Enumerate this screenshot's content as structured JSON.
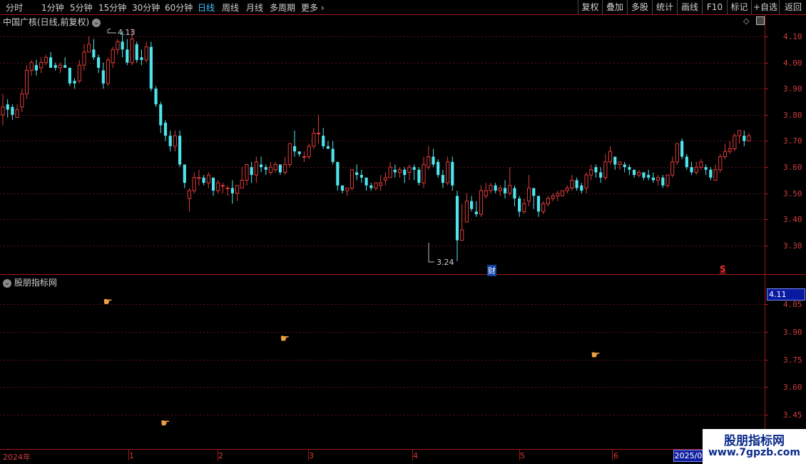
{
  "toolbar": {
    "left_tabs": [
      "分时",
      "1分钟",
      "5分钟",
      "15分钟",
      "30分钟",
      "60分钟",
      "日线",
      "周线",
      "月线",
      "多周期",
      "更多"
    ],
    "active_tab": "日线",
    "right_buttons": [
      "复权",
      "叠加",
      "多股",
      "统计",
      "画线",
      "F10",
      "标记",
      "+自选",
      "返回"
    ]
  },
  "main_panel": {
    "title": "中国广核(日线,前复权)",
    "y_labels": [
      "4.10",
      "4.00",
      "3.90",
      "3.80",
      "3.70",
      "3.60",
      "3.50",
      "3.40",
      "3.30"
    ],
    "high_annotation": "4.13",
    "low_annotation": "3.24",
    "marker_cai": "财",
    "marker_s": "S"
  },
  "indicator_panel": {
    "title": "股朋指标网",
    "y_labels": [
      "4.05",
      "3.90",
      "3.75",
      "3.60",
      "3.45"
    ],
    "current_value": "4.11"
  },
  "x_axis": {
    "labels": [
      "2024年",
      "1",
      "2",
      "3",
      "4",
      "5",
      "6"
    ],
    "current_date": "2025/0"
  },
  "watermark": {
    "line1": "股朋指标网",
    "line2": "www.7gpzb.com"
  },
  "colors": {
    "up": "#e23b3b",
    "down": "#4ee6ee",
    "axis": "#a01818",
    "grid": "#5a1414",
    "active_tab": "#3ec6ff"
  },
  "chart_data": {
    "type": "candlestick",
    "price_range": [
      3.2,
      4.15
    ],
    "candles": [
      [
        3.8,
        3.83,
        3.88,
        3.76
      ],
      [
        3.84,
        3.82,
        3.86,
        3.79
      ],
      [
        3.83,
        3.8,
        3.84,
        3.78
      ],
      [
        3.79,
        3.82,
        3.84,
        3.79
      ],
      [
        3.83,
        3.88,
        3.9,
        3.81
      ],
      [
        3.88,
        3.97,
        3.99,
        3.86
      ],
      [
        3.97,
        4.0,
        4.01,
        3.95
      ],
      [
        3.99,
        3.97,
        4.01,
        3.95
      ],
      [
        3.98,
        4.0,
        4.02,
        3.96
      ],
      [
        4.0,
        4.02,
        4.03,
        3.99
      ],
      [
        4.02,
        3.98,
        4.04,
        3.98
      ],
      [
        3.99,
        3.98,
        4.0,
        3.97
      ],
      [
        3.98,
        3.99,
        4.0,
        3.96
      ],
      [
        3.99,
        3.98,
        4.02,
        3.98
      ],
      [
        3.98,
        3.92,
        3.98,
        3.91
      ],
      [
        3.93,
        3.92,
        3.94,
        3.9
      ],
      [
        3.93,
        3.99,
        4.01,
        3.92
      ],
      [
        3.99,
        4.04,
        4.07,
        3.97
      ],
      [
        4.04,
        4.07,
        4.1,
        4.04
      ],
      [
        4.05,
        4.02,
        4.09,
        4.01
      ],
      [
        4.02,
        3.98,
        4.03,
        3.96
      ],
      [
        3.97,
        3.92,
        4.0,
        3.9
      ],
      [
        3.92,
        4.01,
        4.02,
        3.91
      ],
      [
        4.0,
        4.05,
        4.06,
        3.98
      ],
      [
        4.05,
        4.08,
        4.09,
        4.03
      ],
      [
        4.08,
        4.05,
        4.12,
        4.02
      ],
      [
        4.05,
        4.0,
        4.09,
        3.99
      ],
      [
        4.0,
        4.09,
        4.13,
        3.99
      ],
      [
        4.07,
        4.01,
        4.08,
        4.0
      ],
      [
        4.02,
        4.01,
        4.05,
        3.99
      ],
      [
        4.01,
        4.06,
        4.08,
        4.0
      ],
      [
        4.06,
        3.9,
        4.08,
        3.89
      ],
      [
        3.9,
        3.84,
        3.91,
        3.83
      ],
      [
        3.84,
        3.76,
        3.85,
        3.73
      ],
      [
        3.77,
        3.72,
        3.78,
        3.7
      ],
      [
        3.72,
        3.68,
        3.74,
        3.66
      ],
      [
        3.68,
        3.72,
        3.74,
        3.66
      ],
      [
        3.72,
        3.61,
        3.74,
        3.6
      ],
      [
        3.61,
        3.54,
        3.61,
        3.52
      ],
      [
        3.48,
        3.51,
        3.52,
        3.43
      ],
      [
        3.51,
        3.56,
        3.58,
        3.5
      ],
      [
        3.56,
        3.56,
        3.59,
        3.53
      ],
      [
        3.56,
        3.54,
        3.57,
        3.53
      ],
      [
        3.54,
        3.57,
        3.58,
        3.52
      ],
      [
        3.56,
        3.51,
        3.56,
        3.49
      ],
      [
        3.51,
        3.54,
        3.55,
        3.5
      ],
      [
        3.53,
        3.53,
        3.54,
        3.5
      ],
      [
        3.52,
        3.52,
        3.53,
        3.49
      ],
      [
        3.52,
        3.5,
        3.55,
        3.46
      ],
      [
        3.5,
        3.53,
        3.53,
        3.47
      ],
      [
        3.52,
        3.55,
        3.6,
        3.52
      ],
      [
        3.55,
        3.61,
        3.61,
        3.53
      ],
      [
        3.6,
        3.57,
        3.62,
        3.54
      ],
      [
        3.57,
        3.62,
        3.64,
        3.54
      ],
      [
        3.61,
        3.6,
        3.64,
        3.58
      ],
      [
        3.6,
        3.59,
        3.61,
        3.57
      ],
      [
        3.58,
        3.6,
        3.62,
        3.57
      ],
      [
        3.59,
        3.61,
        3.62,
        3.58
      ],
      [
        3.61,
        3.58,
        3.61,
        3.57
      ],
      [
        3.58,
        3.61,
        3.64,
        3.57
      ],
      [
        3.61,
        3.69,
        3.69,
        3.6
      ],
      [
        3.68,
        3.66,
        3.74,
        3.64
      ],
      [
        3.66,
        3.65,
        3.66,
        3.64
      ],
      [
        3.64,
        3.64,
        3.66,
        3.62
      ],
      [
        3.64,
        3.68,
        3.69,
        3.63
      ],
      [
        3.68,
        3.73,
        3.75,
        3.67
      ],
      [
        3.73,
        3.73,
        3.8,
        3.69
      ],
      [
        3.72,
        3.68,
        3.75,
        3.67
      ],
      [
        3.68,
        3.67,
        3.7,
        3.67
      ],
      [
        3.67,
        3.62,
        3.7,
        3.61
      ],
      [
        3.62,
        3.53,
        3.62,
        3.51
      ],
      [
        3.53,
        3.51,
        3.53,
        3.5
      ],
      [
        3.51,
        3.52,
        3.52,
        3.49
      ],
      [
        3.52,
        3.59,
        3.59,
        3.51
      ],
      [
        3.58,
        3.57,
        3.61,
        3.55
      ],
      [
        3.57,
        3.56,
        3.59,
        3.54
      ],
      [
        3.56,
        3.53,
        3.56,
        3.51
      ],
      [
        3.53,
        3.52,
        3.54,
        3.51
      ],
      [
        3.52,
        3.54,
        3.54,
        3.51
      ],
      [
        3.53,
        3.54,
        3.57,
        3.51
      ],
      [
        3.55,
        3.56,
        3.58,
        3.53
      ],
      [
        3.56,
        3.6,
        3.62,
        3.56
      ],
      [
        3.59,
        3.58,
        3.61,
        3.56
      ],
      [
        3.58,
        3.59,
        3.6,
        3.56
      ],
      [
        3.59,
        3.57,
        3.6,
        3.54
      ],
      [
        3.58,
        3.6,
        3.61,
        3.55
      ],
      [
        3.6,
        3.59,
        3.61,
        3.55
      ],
      [
        3.59,
        3.54,
        3.6,
        3.53
      ],
      [
        3.54,
        3.61,
        3.64,
        3.52
      ],
      [
        3.6,
        3.64,
        3.68,
        3.59
      ],
      [
        3.64,
        3.61,
        3.67,
        3.6
      ],
      [
        3.62,
        3.57,
        3.63,
        3.56
      ],
      [
        3.57,
        3.54,
        3.59,
        3.52
      ],
      [
        3.54,
        3.62,
        3.64,
        3.53
      ],
      [
        3.62,
        3.53,
        3.64,
        3.51
      ],
      [
        3.49,
        3.32,
        3.51,
        3.24
      ],
      [
        3.32,
        3.36,
        3.46,
        3.32
      ],
      [
        3.39,
        3.47,
        3.5,
        3.39
      ],
      [
        3.47,
        3.44,
        3.49,
        3.43
      ],
      [
        3.43,
        3.42,
        3.47,
        3.41
      ],
      [
        3.42,
        3.51,
        3.53,
        3.41
      ],
      [
        3.49,
        3.51,
        3.54,
        3.48
      ],
      [
        3.51,
        3.53,
        3.54,
        3.5
      ],
      [
        3.53,
        3.51,
        3.54,
        3.5
      ],
      [
        3.51,
        3.52,
        3.53,
        3.49
      ],
      [
        3.52,
        3.5,
        3.55,
        3.48
      ],
      [
        3.5,
        3.53,
        3.6,
        3.49
      ],
      [
        3.52,
        3.48,
        3.53,
        3.45
      ],
      [
        3.48,
        3.43,
        3.49,
        3.41
      ],
      [
        3.43,
        3.46,
        3.48,
        3.42
      ],
      [
        3.47,
        3.52,
        3.57,
        3.45
      ],
      [
        3.52,
        3.49,
        3.52,
        3.44
      ],
      [
        3.49,
        3.43,
        3.49,
        3.41
      ],
      [
        3.43,
        3.46,
        3.47,
        3.42
      ],
      [
        3.46,
        3.48,
        3.49,
        3.45
      ],
      [
        3.48,
        3.49,
        3.5,
        3.47
      ],
      [
        3.49,
        3.5,
        3.51,
        3.47
      ],
      [
        3.49,
        3.51,
        3.51,
        3.49
      ],
      [
        3.51,
        3.52,
        3.53,
        3.5
      ],
      [
        3.52,
        3.55,
        3.57,
        3.51
      ],
      [
        3.55,
        3.52,
        3.56,
        3.51
      ],
      [
        3.53,
        3.51,
        3.54,
        3.5
      ],
      [
        3.52,
        3.57,
        3.58,
        3.5
      ],
      [
        3.57,
        3.59,
        3.61,
        3.55
      ],
      [
        3.6,
        3.58,
        3.61,
        3.56
      ],
      [
        3.58,
        3.56,
        3.6,
        3.54
      ],
      [
        3.56,
        3.62,
        3.65,
        3.55
      ],
      [
        3.62,
        3.66,
        3.68,
        3.61
      ],
      [
        3.64,
        3.61,
        3.64,
        3.59
      ],
      [
        3.61,
        3.62,
        3.62,
        3.59
      ],
      [
        3.61,
        3.6,
        3.62,
        3.58
      ],
      [
        3.6,
        3.59,
        3.61,
        3.57
      ],
      [
        3.59,
        3.57,
        3.59,
        3.56
      ],
      [
        3.57,
        3.58,
        3.59,
        3.56
      ],
      [
        3.58,
        3.56,
        3.58,
        3.55
      ],
      [
        3.57,
        3.56,
        3.59,
        3.55
      ],
      [
        3.56,
        3.55,
        3.58,
        3.54
      ],
      [
        3.55,
        3.56,
        3.57,
        3.53
      ],
      [
        3.56,
        3.53,
        3.57,
        3.52
      ],
      [
        3.53,
        3.57,
        3.57,
        3.52
      ],
      [
        3.57,
        3.62,
        3.64,
        3.56
      ],
      [
        3.62,
        3.69,
        3.69,
        3.61
      ],
      [
        3.7,
        3.64,
        3.71,
        3.63
      ],
      [
        3.64,
        3.6,
        3.65,
        3.59
      ],
      [
        3.6,
        3.58,
        3.62,
        3.57
      ],
      [
        3.58,
        3.6,
        3.62,
        3.57
      ],
      [
        3.6,
        3.62,
        3.63,
        3.59
      ],
      [
        3.6,
        3.59,
        3.61,
        3.57
      ],
      [
        3.59,
        3.56,
        3.6,
        3.55
      ],
      [
        3.55,
        3.59,
        3.61,
        3.55
      ],
      [
        3.59,
        3.64,
        3.65,
        3.58
      ],
      [
        3.64,
        3.66,
        3.69,
        3.63
      ],
      [
        3.66,
        3.67,
        3.7,
        3.65
      ],
      [
        3.67,
        3.72,
        3.73,
        3.66
      ],
      [
        3.72,
        3.74,
        3.74,
        3.69
      ],
      [
        3.72,
        3.7,
        3.74,
        3.68
      ],
      [
        3.7,
        3.72,
        3.73,
        3.7
      ]
    ],
    "signals": [
      {
        "index": 22,
        "value": 4.07,
        "glyph": "hand-point"
      },
      {
        "index": 59,
        "value": 3.87,
        "glyph": "hand-point"
      },
      {
        "index": 34,
        "value": 3.41,
        "glyph": "hand-point"
      },
      {
        "index": 124,
        "value": 3.78,
        "glyph": "hand-point"
      }
    ],
    "indicator_range": [
      3.36,
      4.12
    ]
  }
}
